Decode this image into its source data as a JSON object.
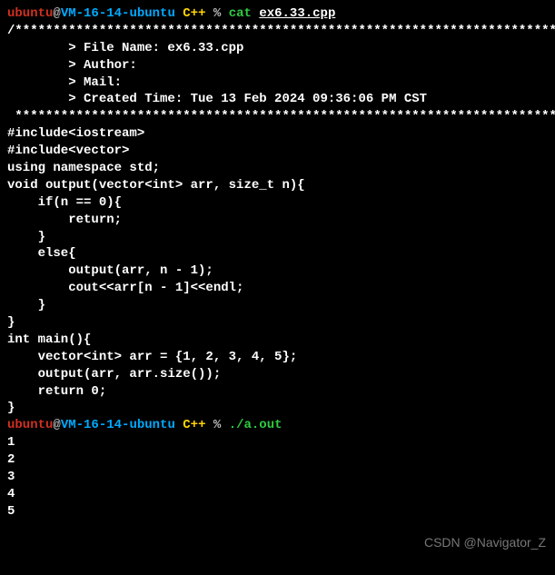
{
  "prompt1": {
    "user": "ubuntu",
    "at": "@",
    "host": "VM-16-14-ubuntu",
    "dir": "C++",
    "pct": "%",
    "cmd": "cat",
    "arg": "ex6.33.cpp"
  },
  "code": {
    "border_top": "/*************************************************************************",
    "file_name": "        > File Name: ex6.33.cpp",
    "author": "        > Author: ",
    "mail": "        > Mail: ",
    "created": "        > Created Time: Tue 13 Feb 2024 09:36:06 PM CST",
    "border_bot": " ************************************************************************/",
    "blank": "",
    "inc1": "#include<iostream>",
    "inc2": "#include<vector>",
    "using": "using namespace std;",
    "fn1": "void output(vector<int> arr, size_t n){",
    "fn2": "    if(n == 0){",
    "fn3": "        return;",
    "fn4": "    }",
    "fn5": "    else{",
    "fn6": "        output(arr, n - 1);",
    "fn7": "        cout<<arr[n - 1]<<endl;",
    "fn8": "    }",
    "fn9": "}",
    "mn1": "int main(){",
    "mn2": "    vector<int> arr = {1, 2, 3, 4, 5};",
    "mn3": "    output(arr, arr.size());",
    "mn4": "    return 0;",
    "mn5": "}"
  },
  "prompt2": {
    "user": "ubuntu",
    "at": "@",
    "host": "VM-16-14-ubuntu",
    "dir": "C++",
    "pct": "%",
    "cmd": "./a.out"
  },
  "output": [
    "1",
    "2",
    "3",
    "4",
    "5"
  ],
  "watermark": "CSDN @Navigator_Z"
}
